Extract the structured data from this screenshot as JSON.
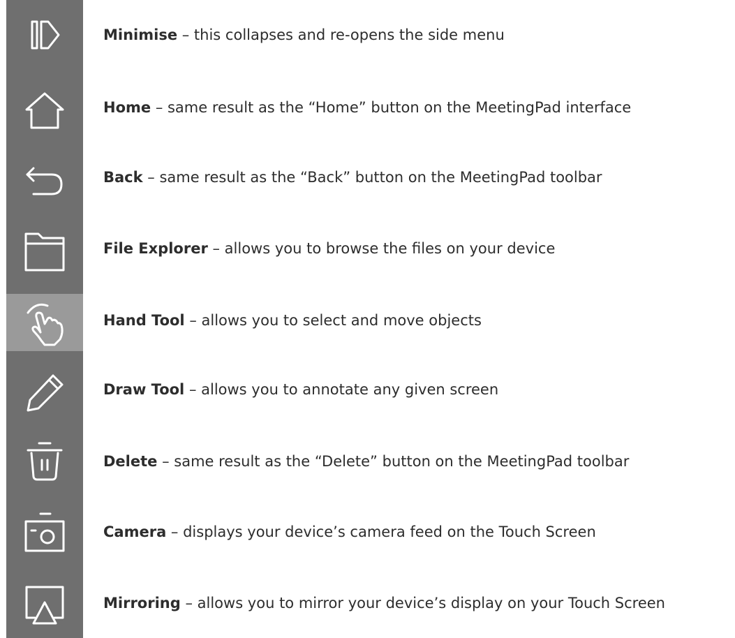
{
  "sidebar": {
    "active_item": "hand-tool",
    "items": [
      {
        "id": "minimise",
        "icon": "minimise-icon"
      },
      {
        "id": "home",
        "icon": "home-icon"
      },
      {
        "id": "back",
        "icon": "back-icon"
      },
      {
        "id": "file-explorer",
        "icon": "folder-icon"
      },
      {
        "id": "hand-tool",
        "icon": "hand-icon"
      },
      {
        "id": "draw-tool",
        "icon": "pencil-icon"
      },
      {
        "id": "delete",
        "icon": "trash-icon"
      },
      {
        "id": "camera",
        "icon": "camera-icon"
      },
      {
        "id": "mirroring",
        "icon": "mirroring-icon"
      }
    ]
  },
  "descriptions": [
    {
      "name": "Minimise",
      "text": " – this collapses and re-opens the side menu"
    },
    {
      "name": "Home",
      "text": " – same result as the “Home” button on the MeetingPad interface"
    },
    {
      "name": "Back",
      "text": " – same result as the “Back” button on the MeetingPad toolbar"
    },
    {
      "name": "File Explorer",
      "text": " – allows you to browse the files on your device"
    },
    {
      "name": "Hand Tool",
      "text": " – allows you to select and move objects"
    },
    {
      "name": "Draw Tool",
      "text": " – allows you to annotate any given screen"
    },
    {
      "name": "Delete",
      "text": " – same result as the “Delete” button on the MeetingPad toolbar"
    },
    {
      "name": "Camera",
      "text": " – displays your device’s camera feed on the Touch Screen"
    },
    {
      "name": "Mirroring",
      "text": " – allows you to mirror your device’s display on your Touch Screen"
    }
  ],
  "colors": {
    "sidebar_bg": "#6f6f6f",
    "active_bg": "#9a9a9a",
    "icon_stroke": "#ffffff",
    "text": "#2d2d2d"
  }
}
